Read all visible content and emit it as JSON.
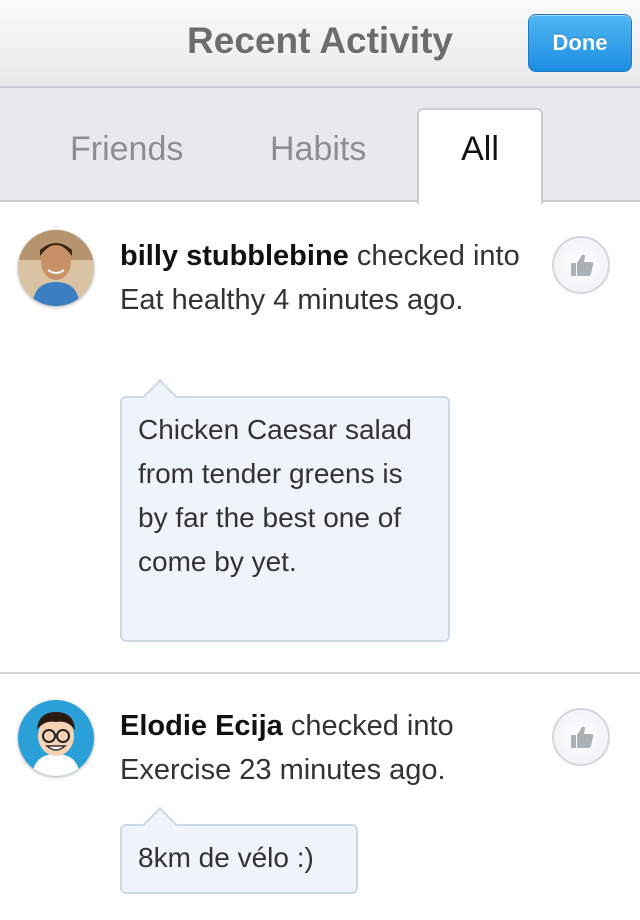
{
  "header": {
    "title": "Recent Activity",
    "done_label": "Done"
  },
  "tabs": [
    {
      "label": "Friends",
      "active": false
    },
    {
      "label": "Habits",
      "active": false
    },
    {
      "label": "All",
      "active": true
    }
  ],
  "feed": [
    {
      "user": "billy stubblebine",
      "action": " checked into Eat healthy 4 minutes ago.",
      "comment": "Chicken Caesar salad from tender greens is by far the best one of come by yet.",
      "avatar_icon": "user-photo-avatar",
      "like_icon": "thumbs-up-icon"
    },
    {
      "user": "Elodie Ecija",
      "action": " checked into Exercise 23 minutes ago.",
      "comment": "8km de vélo :)",
      "avatar_icon": "cartoon-avatar",
      "like_icon": "thumbs-up-icon"
    }
  ],
  "colors": {
    "accent": "#1c8ee2",
    "bubble_bg": "#eff4fb",
    "tab_bg": "#e6eaed"
  }
}
